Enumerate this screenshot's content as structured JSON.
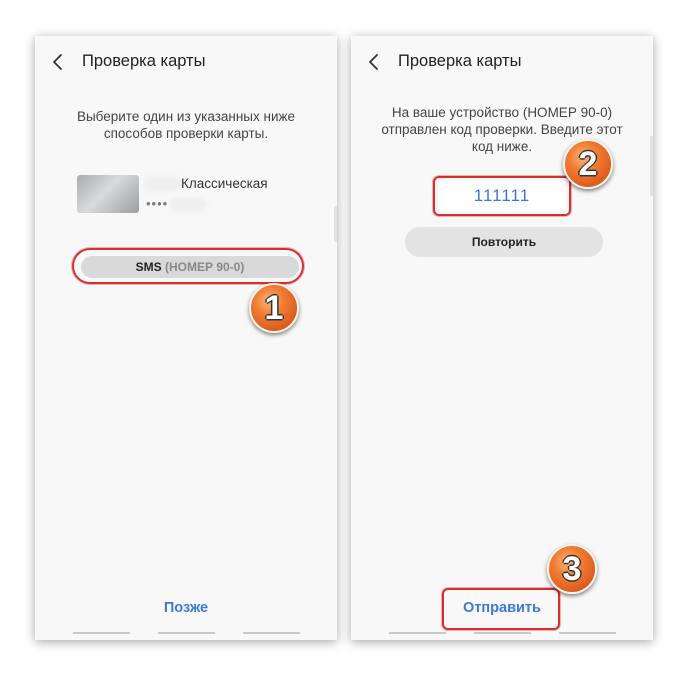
{
  "left_screen": {
    "title": "Проверка карты",
    "description": "Выберите один из указанных ниже способов проверки карты.",
    "card_name": "Классическая",
    "card_mask": "••••",
    "sms_label": "SMS",
    "sms_number": "(НОМЕР 90-0)",
    "later_label": "Позже",
    "step_number": "1"
  },
  "right_screen": {
    "title": "Проверка карты",
    "description": "На ваше устройство (НОМЕР 90-0) отправлен код проверки. Введите этот код ниже.",
    "code_value": "111111",
    "retry_label": "Повторить",
    "send_label": "Отправить",
    "code_step_number": "2",
    "send_step_number": "3"
  },
  "colors": {
    "accent_blue": "#3e78d6",
    "highlight_red": "#d62f2f",
    "badge_orange": "#f07d33"
  },
  "icons": {
    "back": "chevron-left-icon"
  }
}
